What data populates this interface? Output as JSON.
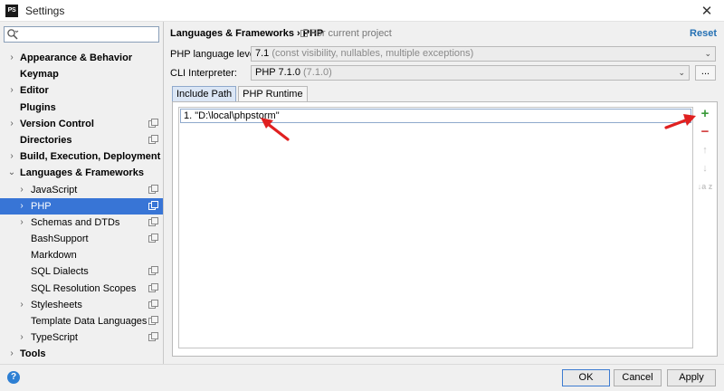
{
  "window": {
    "app_icon_text": "PS",
    "title": "Settings",
    "close_glyph": "✕"
  },
  "sidebar": {
    "search": {
      "value": "",
      "placeholder": ""
    },
    "items": [
      {
        "label": "Appearance & Behavior",
        "bold": true,
        "arrow": "›",
        "level": 0,
        "project_icon": false
      },
      {
        "label": "Keymap",
        "bold": true,
        "arrow": "",
        "level": 0,
        "project_icon": false
      },
      {
        "label": "Editor",
        "bold": true,
        "arrow": "›",
        "level": 0,
        "project_icon": false
      },
      {
        "label": "Plugins",
        "bold": true,
        "arrow": "",
        "level": 0,
        "project_icon": false
      },
      {
        "label": "Version Control",
        "bold": true,
        "arrow": "›",
        "level": 0,
        "project_icon": true
      },
      {
        "label": "Directories",
        "bold": true,
        "arrow": "",
        "level": 0,
        "project_icon": true
      },
      {
        "label": "Build, Execution, Deployment",
        "bold": true,
        "arrow": "›",
        "level": 0,
        "project_icon": false
      },
      {
        "label": "Languages & Frameworks",
        "bold": true,
        "arrow": "⌄",
        "level": 0,
        "project_icon": false
      },
      {
        "label": "JavaScript",
        "bold": false,
        "arrow": "›",
        "level": 1,
        "project_icon": true
      },
      {
        "label": "PHP",
        "bold": false,
        "arrow": "›",
        "level": 1,
        "project_icon": true,
        "selected": true
      },
      {
        "label": "Schemas and DTDs",
        "bold": false,
        "arrow": "›",
        "level": 1,
        "project_icon": true
      },
      {
        "label": "BashSupport",
        "bold": false,
        "arrow": "",
        "level": 1,
        "project_icon": true
      },
      {
        "label": "Markdown",
        "bold": false,
        "arrow": "",
        "level": 1,
        "project_icon": false
      },
      {
        "label": "SQL Dialects",
        "bold": false,
        "arrow": "",
        "level": 1,
        "project_icon": true
      },
      {
        "label": "SQL Resolution Scopes",
        "bold": false,
        "arrow": "",
        "level": 1,
        "project_icon": true
      },
      {
        "label": "Stylesheets",
        "bold": false,
        "arrow": "›",
        "level": 1,
        "project_icon": true
      },
      {
        "label": "Template Data Languages",
        "bold": false,
        "arrow": "",
        "level": 1,
        "project_icon": true
      },
      {
        "label": "TypeScript",
        "bold": false,
        "arrow": "›",
        "level": 1,
        "project_icon": true
      },
      {
        "label": "Tools",
        "bold": true,
        "arrow": "›",
        "level": 0,
        "project_icon": false
      }
    ]
  },
  "main": {
    "breadcrumb": {
      "parent": "Languages & Frameworks",
      "sep": "›",
      "current": "PHP"
    },
    "scope_note": "For current project",
    "reset_label": "Reset",
    "php_level": {
      "label": "PHP language level:",
      "value": "7.1",
      "hint": "(const visibility, nullables, multiple exceptions)",
      "chevron": "⌄"
    },
    "cli_interpreter": {
      "label": "CLI Interpreter:",
      "value": "PHP 7.1.0",
      "hint": "(7.1.0)",
      "chevron": "⌄",
      "browse": "..."
    },
    "tabs": [
      {
        "label": "Include Path",
        "active": true
      },
      {
        "label": "PHP Runtime",
        "active": false
      }
    ],
    "include_paths": [
      "1. \"D:\\local\\phpstorm\""
    ],
    "toolbar": {
      "add": "+",
      "remove": "−",
      "up": "↑",
      "down": "↓",
      "sort": "↓a z"
    }
  },
  "footer": {
    "help": "?",
    "ok": "OK",
    "cancel": "Cancel",
    "apply": "Apply"
  },
  "colors": {
    "selection": "#3875d6",
    "link": "#2470b3",
    "annotation_arrow": "#e02020",
    "add_green": "#3a9a3a",
    "remove_red": "#d23d3d"
  }
}
